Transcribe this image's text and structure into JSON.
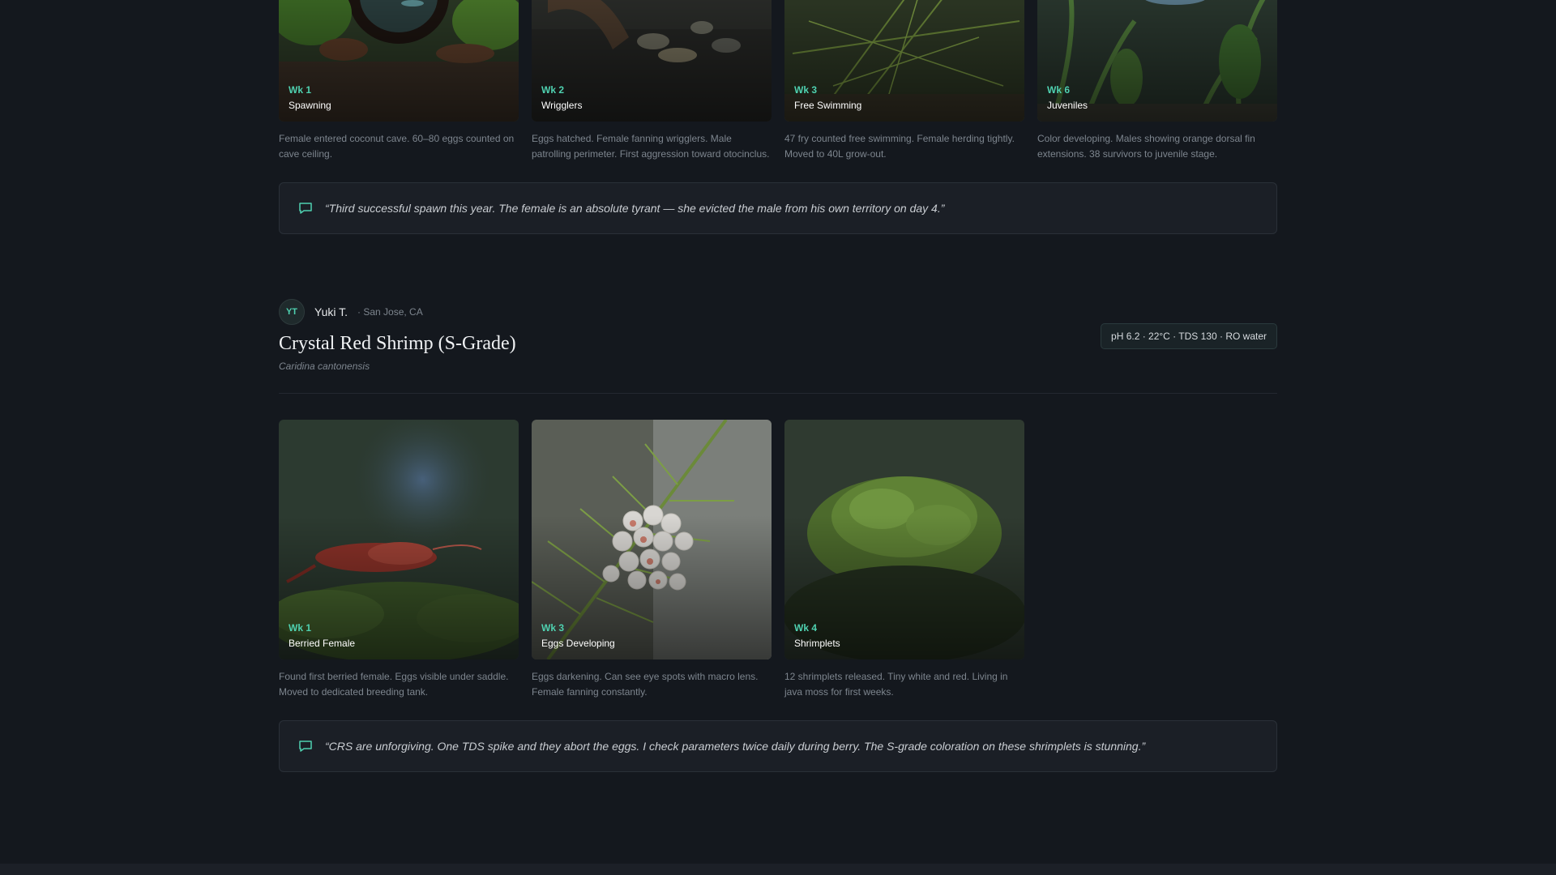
{
  "first_species": {
    "stages": [
      {
        "week": "Wk 1",
        "stage": "Spawning",
        "description": "Female entered coconut cave. 60–80 eggs counted on cave ceiling."
      },
      {
        "week": "Wk 2",
        "stage": "Wrigglers",
        "description": "Eggs hatched. Female fanning wrigglers. Male patrolling perimeter. First aggression toward otocinclus."
      },
      {
        "week": "Wk 3",
        "stage": "Free Swimming",
        "description": "47 fry counted free swimming. Female herding tightly. Moved to 40L grow-out."
      },
      {
        "week": "Wk 6",
        "stage": "Juveniles",
        "description": "Color developing. Males showing orange dorsal fin extensions. 38 survivors to juvenile stage."
      }
    ],
    "quote": "“Third successful spawn this year. The female is an absolute tyrant — she evicted the male from his own territory on day 4.”"
  },
  "second_species": {
    "author": {
      "initials": "YT",
      "name": "Yuki T.",
      "location": "· San Jose, CA"
    },
    "title": "Crystal Red Shrimp (S-Grade)",
    "latin": "Caridina cantonensis",
    "params": "pH 6.2 · 22°C · TDS 130 · RO water",
    "stages": [
      {
        "week": "Wk 1",
        "stage": "Berried Female",
        "description": "Found first berried female. Eggs visible under saddle. Moved to dedicated breeding tank."
      },
      {
        "week": "Wk 3",
        "stage": "Eggs Developing",
        "description": "Eggs darkening. Can see eye spots with macro lens. Female fanning constantly."
      },
      {
        "week": "Wk 4",
        "stage": "Shrimplets",
        "description": "12 shrimplets released. Tiny white and red. Living in java moss for first weeks."
      }
    ],
    "quote": "“CRS are unforgiving. One TDS spike and they abort the eggs. I check parameters twice daily during berry. The S-grade coloration on these shrimplets is stunning.”"
  },
  "colors": {
    "accent": "#4fd1b0",
    "background": "#14181e",
    "card": "#1b1f26"
  }
}
